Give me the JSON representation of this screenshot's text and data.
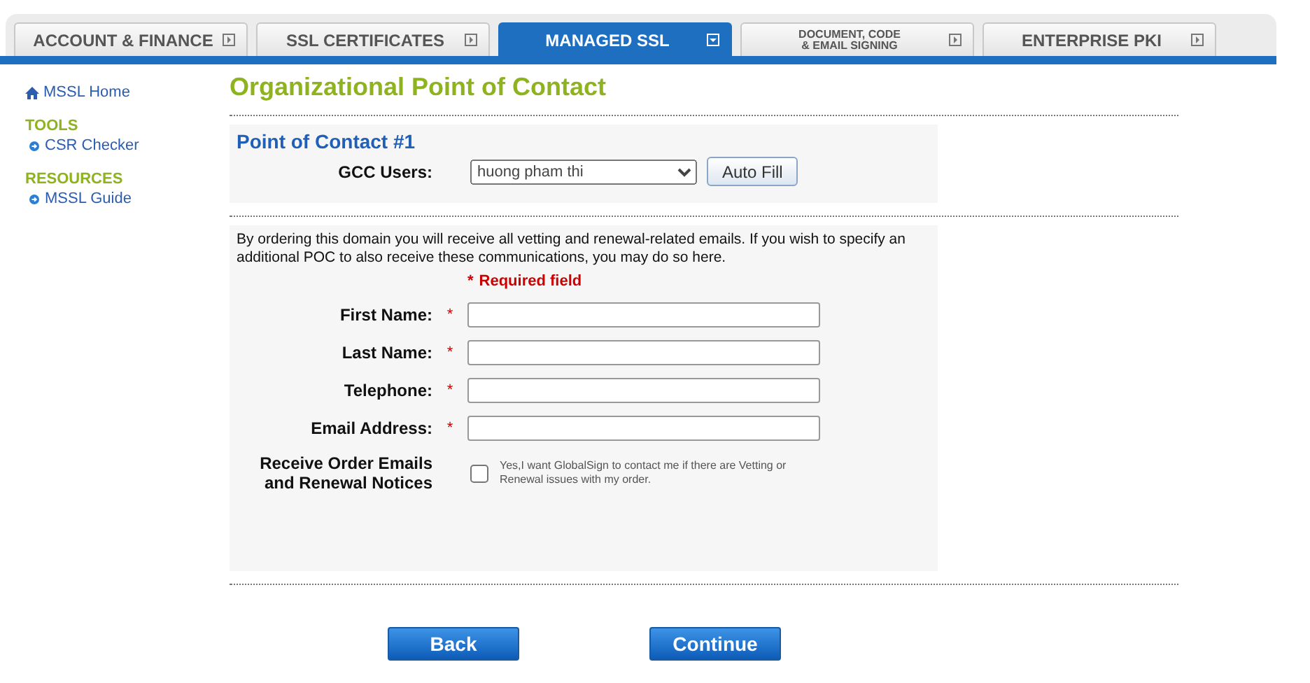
{
  "tabs": [
    {
      "label": "ACCOUNT & FINANCE",
      "selected": false
    },
    {
      "label": "SSL CERTIFICATES",
      "selected": false
    },
    {
      "label": "MANAGED SSL",
      "selected": true
    },
    {
      "label": "DOCUMENT, CODE\n& EMAIL SIGNING",
      "selected": false
    },
    {
      "label": "ENTERPRISE PKI",
      "selected": false
    }
  ],
  "sidebar": {
    "home": "MSSL Home",
    "sections": [
      {
        "title": "TOOLS",
        "items": [
          "CSR Checker"
        ]
      },
      {
        "title": "RESOURCES",
        "items": [
          "MSSL Guide"
        ]
      }
    ]
  },
  "page_title": "Organizational Point of Contact",
  "contact": {
    "heading": "Point of Contact #1",
    "gcc_label": "GCC Users:",
    "gcc_value": "huong pham thi",
    "autofill": "Auto Fill"
  },
  "intro": "By ordering this domain you will receive all vetting and renewal-related emails. If you wish to specify an additional POC to also receive these communications, you may do so here.",
  "required_note": {
    "star": "*",
    "text": "Required field"
  },
  "fields": [
    {
      "label": "First Name:",
      "star": "*"
    },
    {
      "label": "Last Name:",
      "star": "*"
    },
    {
      "label": "Telephone:",
      "star": "*"
    },
    {
      "label": "Email Address:",
      "star": "*"
    }
  ],
  "receive": {
    "label": "Receive Order Emails\nand Renewal Notices",
    "checked": false,
    "text": "Yes,I want GlobalSign to contact me if there are Vetting or Renewal issues with my order."
  },
  "buttons": [
    "Back",
    "Continue"
  ]
}
